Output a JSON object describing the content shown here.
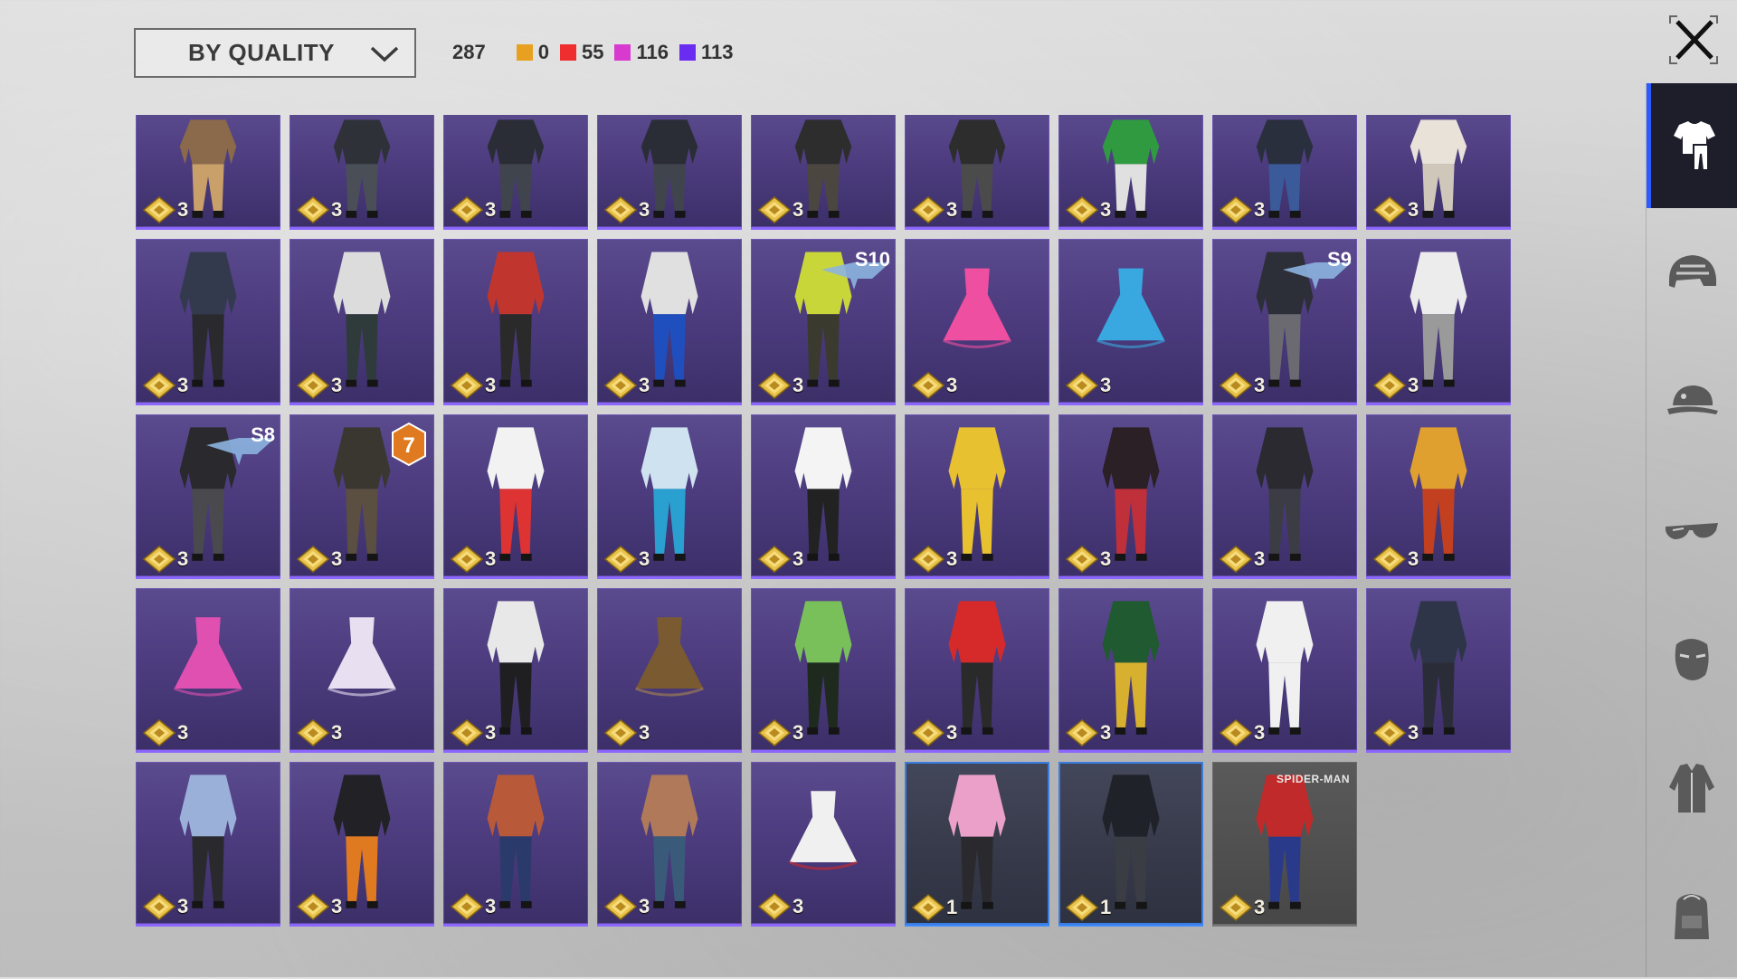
{
  "header": {
    "sort_label": "BY QUALITY",
    "total_count": "287",
    "quality_counts": [
      {
        "name": "orange",
        "color": "#e8a020",
        "count": "0"
      },
      {
        "name": "red",
        "color": "#ef2f2f",
        "count": "55"
      },
      {
        "name": "pink",
        "color": "#d83ad0",
        "count": "116"
      },
      {
        "name": "purple",
        "color": "#6a2cf0",
        "count": "113"
      }
    ]
  },
  "sidebar": {
    "categories": [
      {
        "name": "outfit-category-icon",
        "active": true
      },
      {
        "name": "helmet-category-icon",
        "active": false
      },
      {
        "name": "hat-category-icon",
        "active": false
      },
      {
        "name": "glasses-category-icon",
        "active": false
      },
      {
        "name": "mask-category-icon",
        "active": false
      },
      {
        "name": "jacket-category-icon",
        "active": false
      },
      {
        "name": "backpack-category-icon",
        "active": false
      }
    ]
  },
  "items": [
    {
      "price": "3",
      "rarity": "purple",
      "colors": [
        "#8a6a4a",
        "#c9a06a"
      ]
    },
    {
      "price": "3",
      "rarity": "purple",
      "colors": [
        "#2e3238",
        "#4a4f57"
      ]
    },
    {
      "price": "3",
      "rarity": "purple",
      "colors": [
        "#2a2d35",
        "#3f444d"
      ]
    },
    {
      "price": "3",
      "rarity": "purple",
      "colors": [
        "#2a2d35",
        "#3f444d"
      ]
    },
    {
      "price": "3",
      "rarity": "purple",
      "colors": [
        "#2d2d2d",
        "#4c4640"
      ]
    },
    {
      "price": "3",
      "rarity": "purple",
      "colors": [
        "#2d2d2d",
        "#4b4b4b"
      ]
    },
    {
      "price": "3",
      "rarity": "purple",
      "colors": [
        "#2f9a3f",
        "#e0e0e0"
      ]
    },
    {
      "price": "3",
      "rarity": "purple",
      "colors": [
        "#2a2f3d",
        "#3a5a9a"
      ]
    },
    {
      "price": "3",
      "rarity": "purple",
      "colors": [
        "#e8e2d8",
        "#cfc7ba"
      ]
    },
    {
      "price": "3",
      "rarity": "purple",
      "colors": [
        "#343a4e",
        "#2a2a2e"
      ]
    },
    {
      "price": "3",
      "rarity": "purple",
      "colors": [
        "#dcdcdc",
        "#2f3b3a"
      ]
    },
    {
      "price": "3",
      "rarity": "purple",
      "colors": [
        "#c0362e",
        "#2a2a2a"
      ]
    },
    {
      "price": "3",
      "rarity": "purple",
      "colors": [
        "#e0e0e0",
        "#1f4fbf"
      ]
    },
    {
      "price": "3",
      "rarity": "purple",
      "colors": [
        "#c9d63a",
        "#3a3a2e"
      ],
      "badge": "S10"
    },
    {
      "price": "3",
      "rarity": "purple",
      "colors": [
        "#ee4fa0",
        "#ee4fa0"
      ],
      "dress": true
    },
    {
      "price": "3",
      "rarity": "purple",
      "colors": [
        "#3aa8e0",
        "#3aa8e0"
      ],
      "dress": true
    },
    {
      "price": "3",
      "rarity": "purple",
      "colors": [
        "#2d2f38",
        "#6a6a70"
      ],
      "badge": "S9"
    },
    {
      "price": "3",
      "rarity": "purple",
      "colors": [
        "#ececec",
        "#9a9a9a"
      ]
    },
    {
      "price": "3",
      "rarity": "purple",
      "colors": [
        "#2a2a2e",
        "#4a4a4e"
      ],
      "badge": "S8"
    },
    {
      "price": "3",
      "rarity": "purple",
      "colors": [
        "#3a3630",
        "#5a4f40"
      ],
      "badge": "7"
    },
    {
      "price": "3",
      "rarity": "purple",
      "colors": [
        "#f2f2f2",
        "#d33"
      ]
    },
    {
      "price": "3",
      "rarity": "purple",
      "colors": [
        "#cfe2f0",
        "#2aa0d0"
      ]
    },
    {
      "price": "3",
      "rarity": "purple",
      "colors": [
        "#f4f4f4",
        "#222"
      ]
    },
    {
      "price": "3",
      "rarity": "purple",
      "colors": [
        "#e8c130",
        "#e8c130"
      ]
    },
    {
      "price": "3",
      "rarity": "purple",
      "colors": [
        "#2a2026",
        "#c0303a"
      ]
    },
    {
      "price": "3",
      "rarity": "purple",
      "colors": [
        "#2a2a30",
        "#3c3c44"
      ]
    },
    {
      "price": "3",
      "rarity": "purple",
      "colors": [
        "#e0a030",
        "#c24020"
      ]
    },
    {
      "price": "3",
      "rarity": "purple",
      "colors": [
        "#e050b0",
        "#e050b0"
      ],
      "dress": true
    },
    {
      "price": "3",
      "rarity": "purple",
      "colors": [
        "#e8dff0",
        "#e8dff0"
      ],
      "dress": true
    },
    {
      "price": "3",
      "rarity": "purple",
      "colors": [
        "#e8e8e8",
        "#1f1f22"
      ]
    },
    {
      "price": "3",
      "rarity": "purple",
      "colors": [
        "#7a5a30",
        "#a8864e"
      ],
      "dress": true
    },
    {
      "price": "3",
      "rarity": "purple",
      "colors": [
        "#7ac05a",
        "#1f2a1f"
      ]
    },
    {
      "price": "3",
      "rarity": "purple",
      "colors": [
        "#d62a2a",
        "#2a2a2a"
      ]
    },
    {
      "price": "3",
      "rarity": "purple",
      "colors": [
        "#1f5a30",
        "#d8b030"
      ]
    },
    {
      "price": "3",
      "rarity": "purple",
      "colors": [
        "#f0f0f0",
        "#f0f0f0"
      ]
    },
    {
      "price": "3",
      "rarity": "purple",
      "colors": [
        "#2f3548",
        "#2a2d38"
      ]
    },
    {
      "price": "3",
      "rarity": "purple",
      "colors": [
        "#9ab0d8",
        "#2a2a2e"
      ]
    },
    {
      "price": "3",
      "rarity": "purple",
      "colors": [
        "#222226",
        "#e07a20"
      ]
    },
    {
      "price": "3",
      "rarity": "purple",
      "colors": [
        "#b85a3a",
        "#2a3a6a"
      ]
    },
    {
      "price": "3",
      "rarity": "purple",
      "colors": [
        "#b07a5a",
        "#3a5a7a"
      ]
    },
    {
      "price": "3",
      "rarity": "purple",
      "colors": [
        "#f0f0f0",
        "#d02a2a"
      ],
      "dress": true
    },
    {
      "price": "1",
      "rarity": "blue",
      "colors": [
        "#eaa0c8",
        "#2a2a2e"
      ]
    },
    {
      "price": "1",
      "rarity": "blue",
      "colors": [
        "#1f2228",
        "#3a3d44"
      ]
    },
    {
      "price": "3",
      "rarity": "grey",
      "colors": [
        "#c02a2a",
        "#2a3a8a"
      ],
      "brand": "SPIDER-MAN"
    }
  ]
}
